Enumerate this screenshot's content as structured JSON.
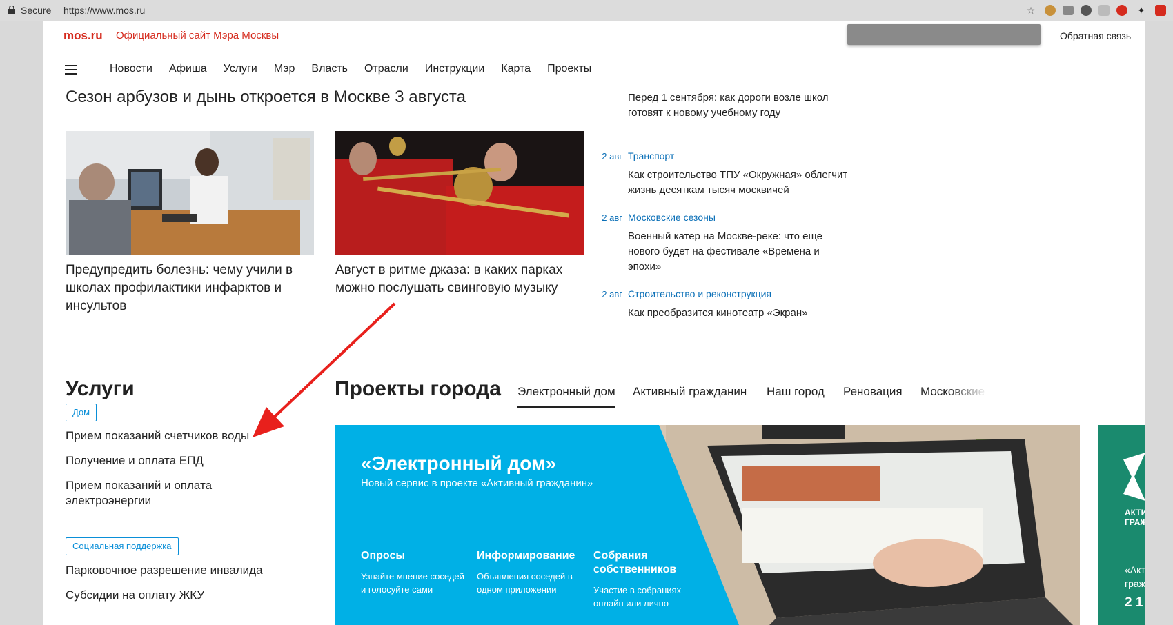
{
  "browser": {
    "secure_label": "Secure",
    "url": "https://www.mos.ru"
  },
  "header": {
    "logo": "mos.ru",
    "site_title": "Официальный сайт Мэра Москвы",
    "feedback": "Обратная связь"
  },
  "nav": {
    "items": [
      "Новости",
      "Афиша",
      "Услуги",
      "Мэр",
      "Власть",
      "Отрасли",
      "Инструкции",
      "Карта",
      "Проекты"
    ]
  },
  "news": {
    "headline": "Сезон арбузов и дынь откроется в Москве 3 августа",
    "cards": [
      {
        "title": "Предупредить болезнь: чему учили в школах профилактики инфарктов и инсультов"
      },
      {
        "title": "Август в ритме джаза: в каких парках можно послушать свинговую музыку"
      }
    ],
    "feed": [
      {
        "date": "",
        "category": "",
        "text": "Перед 1 сентября: как дороги возле школ готовят к новому учебному году"
      },
      {
        "date": "2 авг",
        "category": "Транспорт",
        "text": "Как строительство ТПУ «Окружная» облегчит жизнь десяткам тысяч москвичей"
      },
      {
        "date": "2 авг",
        "category": "Московские сезоны",
        "text": "Военный катер на Москве-реке: что еще нового будет на фестивале «Времена и эпохи»"
      },
      {
        "date": "2 авг",
        "category": "Строительство и реконструкция",
        "text": "Как преобразится кинотеатр «Экран»"
      }
    ]
  },
  "services": {
    "title": "Услуги",
    "groups": [
      {
        "tag": "Дом",
        "items": [
          "Прием показаний счетчиков воды",
          "Получение и оплата ЕПД",
          "Прием показаний и оплата электроэнергии"
        ]
      },
      {
        "tag": "Социальная поддержка",
        "items": [
          "Парковочное разрешение инвалида",
          "Субсидии на оплату ЖКУ"
        ]
      }
    ]
  },
  "projects": {
    "title": "Проекты города",
    "tabs": [
      "Электронный дом",
      "Активный гражданин",
      "Наш город",
      "Реновация",
      "Московские"
    ],
    "banner": {
      "title": "«Электронный дом»",
      "subtitle": "Новый сервис в проекте «Активный гражданин»",
      "features": [
        {
          "heading": "Опросы",
          "text": "Узнайте мнение соседей и голосуйте сами"
        },
        {
          "heading": "Информирование",
          "text": "Объявления соседей в одном приложении"
        },
        {
          "heading": "Собрания собственников",
          "text": "Участие в собраниях онлайн или лично"
        }
      ]
    },
    "side_banner": {
      "line1": "АКТИ",
      "line2": "ГРАЖ",
      "text": "«Акт граж",
      "number": "2 1"
    }
  },
  "colors": {
    "brand_red": "#d52b1e",
    "link_blue": "#0a6fb7",
    "banner_blue": "#00b0e6",
    "annotation_red": "#e8201c"
  }
}
